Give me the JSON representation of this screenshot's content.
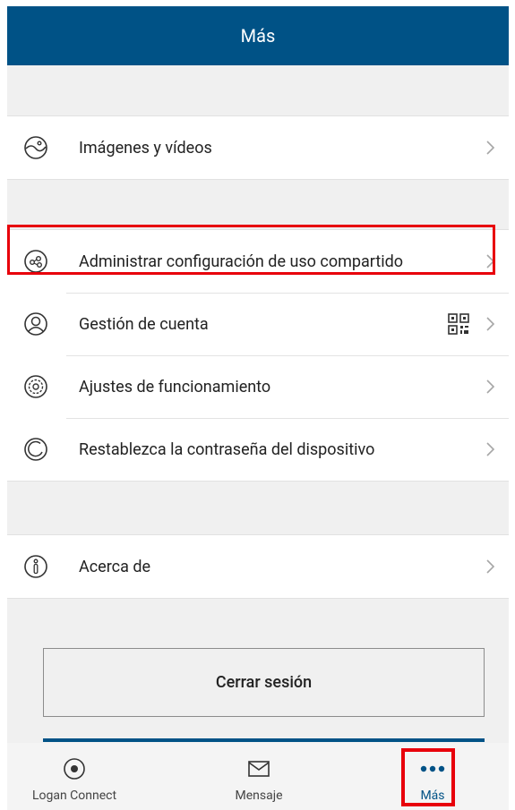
{
  "header": {
    "title": "Más"
  },
  "sections": {
    "media": {
      "label": "Imágenes y vídeos",
      "icon": "image-icon"
    },
    "share": {
      "label": "Administrar configuración de uso compartido",
      "icon": "share-icon"
    },
    "account": {
      "label": "Gestión de cuenta",
      "icon": "user-icon"
    },
    "settings": {
      "label": "Ajustes de funcionamiento",
      "icon": "gear-icon"
    },
    "reset": {
      "label": "Restablezca la contraseña del dispositivo",
      "icon": "reset-icon"
    },
    "about": {
      "label": "Acerca de",
      "icon": "info-icon"
    }
  },
  "logout": {
    "label": "Cerrar sesión"
  },
  "tabbar": {
    "tabs": [
      {
        "label": "Logan Connect",
        "icon": "target-icon"
      },
      {
        "label": "Mensaje",
        "icon": "envelope-icon"
      },
      {
        "label": "Más",
        "icon": "more-dots-icon"
      }
    ],
    "active_index": 2
  },
  "colors": {
    "primary": "#005286",
    "highlight": "#e8000b",
    "background": "#f0f0f0"
  }
}
